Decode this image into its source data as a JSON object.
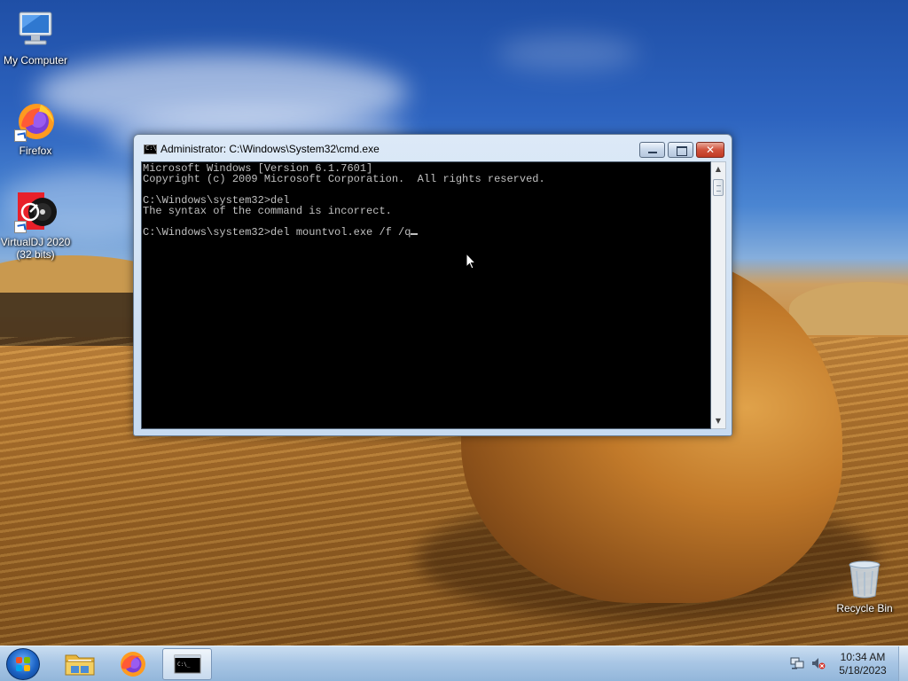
{
  "desktop": {
    "icons": [
      {
        "label": "My Computer",
        "icon": "computer-icon"
      },
      {
        "label": "Firefox",
        "icon": "firefox-icon"
      },
      {
        "label": "VirtualDJ 2020\n(32 bits)",
        "icon": "virtualdj-icon"
      },
      {
        "label": "Recycle Bin",
        "icon": "recycle-bin-icon"
      }
    ]
  },
  "window": {
    "title": "Administrator: C:\\Windows\\System32\\cmd.exe",
    "close_glyph": "✕",
    "console_lines": [
      "Microsoft Windows [Version 6.1.7601]",
      "Copyright (c) 2009 Microsoft Corporation.  All rights reserved.",
      "",
      "C:\\Windows\\system32>del",
      "The syntax of the command is incorrect.",
      "",
      "C:\\Windows\\system32>del mountvol.exe /f /q"
    ],
    "scroll_up": "▲",
    "scroll_down": "▼"
  },
  "taskbar": {
    "items": [
      "start-button",
      "windows-explorer",
      "firefox",
      "command-prompt"
    ],
    "active_item": "command-prompt",
    "clock": {
      "time": "10:34 AM",
      "date": "5/18/2023"
    }
  },
  "colors": {
    "console_bg": "#000000",
    "console_fg": "#c0c0c0",
    "close_red": "#c03a24",
    "taskbar": "#a5c4e4"
  }
}
